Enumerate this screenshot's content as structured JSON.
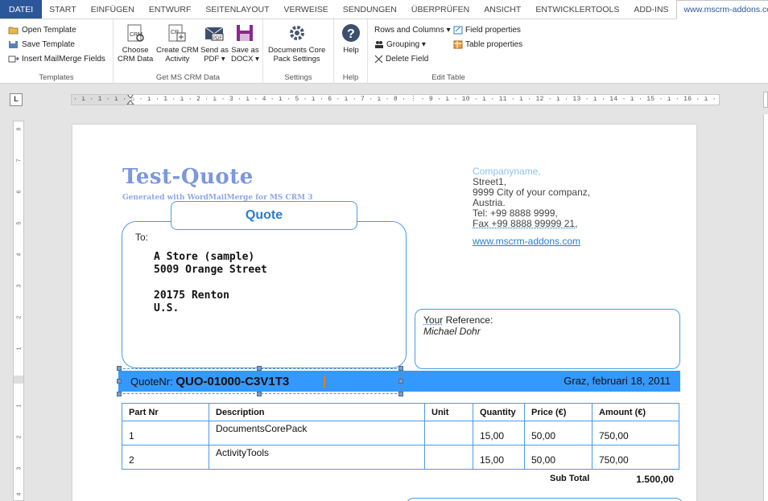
{
  "tabs": [
    {
      "label": "DATEI"
    },
    {
      "label": "START"
    },
    {
      "label": "EINFÜGEN"
    },
    {
      "label": "ENTWURF"
    },
    {
      "label": "SEITENLAYOUT"
    },
    {
      "label": "VERWEISE"
    },
    {
      "label": "SENDUNGEN"
    },
    {
      "label": "ÜBERPRÜFEN"
    },
    {
      "label": "ANSICHT"
    },
    {
      "label": "ENTWICKLERTOOLS"
    },
    {
      "label": "ADD-INS"
    },
    {
      "label": "www.mscrm-addons.com"
    }
  ],
  "ribbon": {
    "templates": {
      "label": "Templates",
      "open": "Open Template",
      "save": "Save Template",
      "insert": "Insert MailMerge Fields"
    },
    "crm": {
      "label": "Get MS CRM Data",
      "choose": [
        "Choose",
        "CRM Data"
      ],
      "create": [
        "Create CRM",
        "Activity"
      ],
      "sendpdf": [
        "Send as",
        "PDF ▾"
      ],
      "savedocx": [
        "Save as",
        "DOCX ▾"
      ]
    },
    "settings": {
      "label": "Settings",
      "btn": [
        "Documents Core",
        "Pack Settings"
      ]
    },
    "help": {
      "label": "Help",
      "btn": "Help"
    },
    "edit": {
      "label": "Edit Table",
      "rows": "Rows and Columns ▾",
      "grouping": "Grouping ▾",
      "delete": "Delete Field",
      "fieldprops": "Field properties",
      "tableprops": "Table properties"
    }
  },
  "ruler": {
    "corner": "L",
    "text": "· ı · 1 · ı · ⌂ · ı · 1 · ı · 2 · ı · 3 · ı · 4 · ı · 5 · ı · 6 · ı · 7 · ı · 8 · ⋮ · 9 · ı · 10 · ı · 11 · ı · 12 · ı · 13 · ı · 14 · ı · 15 · ı · 16 · ı · 17 · ı · 18 · ı · 19"
  },
  "vruler": [
    "8",
    "7",
    "6",
    "5",
    "4",
    "3",
    "2",
    "1",
    "1",
    "2",
    "3",
    "4"
  ],
  "document": {
    "title": "Test-Quote",
    "subtitle": "Generated with WordMailMerge for MS CRM 3",
    "company": {
      "name": "Companyname,",
      "street": "Street1,",
      "city": "9999  City of your companz,",
      "country": "Austria.",
      "tel": "Tel: +99 8888 9999,",
      "fax": "Fax +99 8888 99999 21,",
      "web": "www.mscrm-addons.com"
    },
    "quote_label": "Quote",
    "to_label": "To:",
    "address": {
      "line1": "A Store (sample)",
      "line2": "5009 Orange Street",
      "line3": "20175 Renton",
      "line4": "U.S."
    },
    "reference": {
      "label": "Your",
      "label2": " Reference:",
      "name": "Michael Dohr"
    },
    "band": {
      "prefix": "QuoteNr: ",
      "number": "QUO-01000-C3V1T3",
      "date": "Graz,  februari 18, 2011"
    },
    "table": {
      "headers": [
        "Part Nr",
        "Description",
        "Unit",
        "Quantity",
        "Price (€)",
        "Amount (€)"
      ],
      "rows": [
        [
          "1",
          "DocumentsCorePack",
          "",
          "15,00",
          "50,00",
          "750,00"
        ],
        [
          "2",
          "ActivityTools",
          "",
          "15,00",
          "50,00",
          "750,00"
        ]
      ]
    },
    "subtotal": {
      "label": "Sub Total",
      "value": "1.500,00"
    }
  }
}
